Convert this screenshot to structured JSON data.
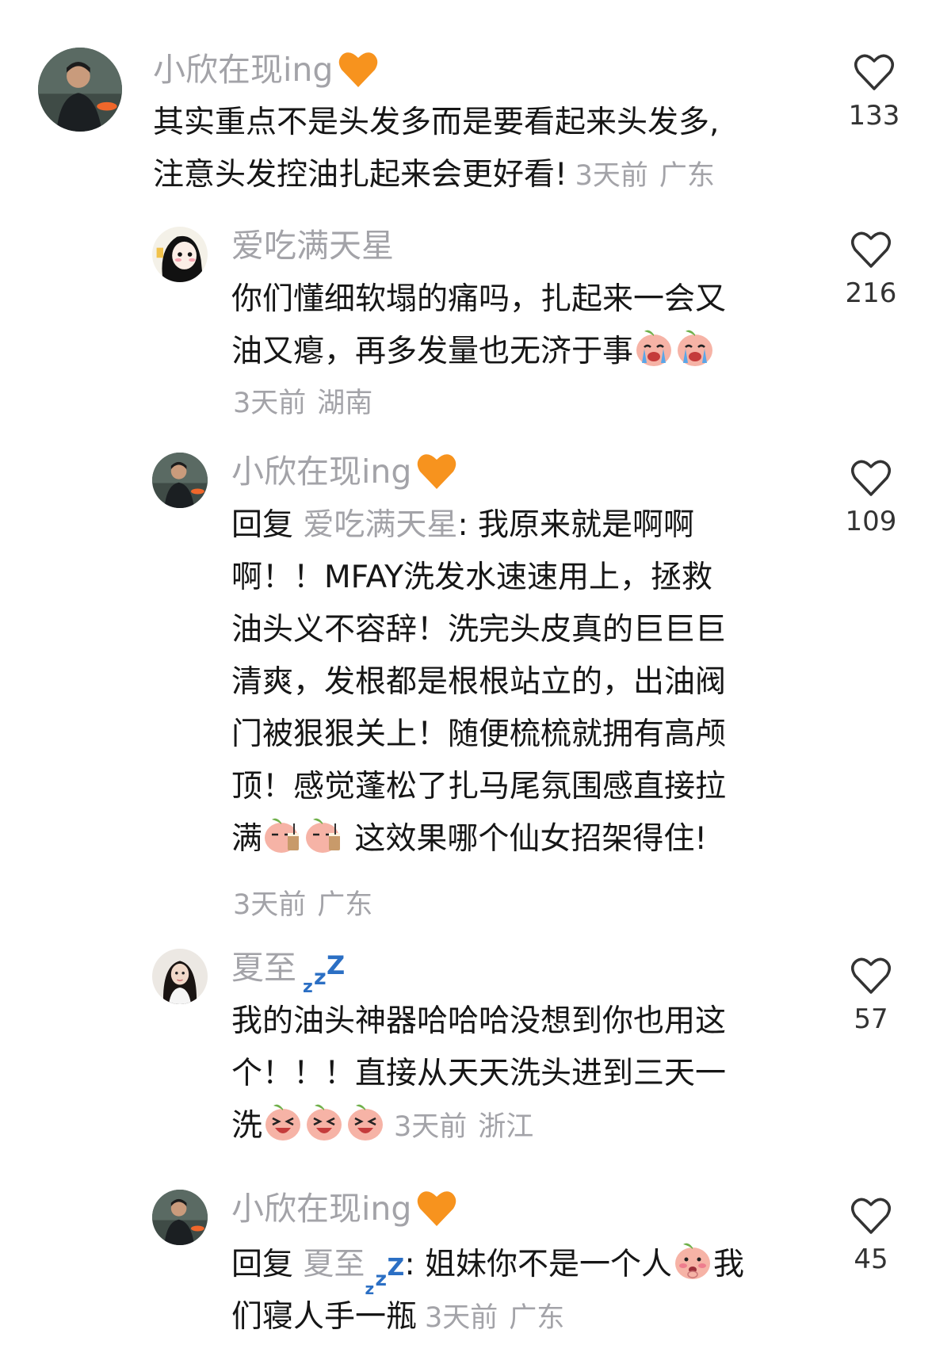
{
  "comments": [
    {
      "username": "小欣在现ing",
      "lines": [
        "其实重点不是头发多而是要看起来头发多,",
        "注意头发控油扎起来会更好看!"
      ],
      "time": "3天前",
      "location": "广东",
      "likes": "133"
    },
    {
      "username": "爱吃满天星",
      "lines": [
        "你们懂细软塌的痛吗，扎起来一会又",
        "油又瘪，再多发量也无济于事"
      ],
      "time": "3天前",
      "location": "湖南",
      "likes": "216"
    },
    {
      "username": "小欣在现ing",
      "reply_prefix": "回复",
      "reply_target": "爱吃满天星",
      "lines": [
        ": 我原来就是啊啊",
        "啊！！MFAY洗发水速速用上，拯救",
        "油头义不容辞！洗完头皮真的巨巨巨",
        "清爽，发根都是根根站立的，出油阀",
        "门被狠狠关上！随便梳梳就拥有高颅",
        "顶！感觉蓬松了扎马尾氛围感直接拉",
        "满",
        "这效果哪个仙女招架得住!"
      ],
      "time": "3天前",
      "location": "广东",
      "likes": "109"
    },
    {
      "username": "夏至",
      "lines": [
        "我的油头神器哈哈哈没想到你也用这",
        "个！！！直接从天天洗头进到三天一",
        "洗"
      ],
      "time": "3天前",
      "location": "浙江",
      "likes": "57"
    },
    {
      "username": "小欣在现ing",
      "reply_prefix": "回复",
      "reply_target": "夏至",
      "lines": [
        ": 姐妹你不是一个人",
        "我",
        "们寝人手一瓶"
      ],
      "time": "3天前",
      "location": "广东",
      "likes": "45"
    }
  ],
  "icons": {
    "username_badge": "orange-heart-icon",
    "sleep_badge": "zzz-icon",
    "like": "heart-outline-icon",
    "emoji_crying": "crying-peach-icon",
    "emoji_drink": "milk-tea-peach-icon",
    "emoji_laugh": "laughing-peach-icon",
    "emoji_shy": "shy-peach-icon"
  },
  "colors": {
    "username": "#a3a3a8",
    "body_text": "#161616",
    "meta": "#a3a3a8",
    "orange_heart": "#f7931e",
    "zzz": "#2b6fc4",
    "background": "#ffffff"
  }
}
